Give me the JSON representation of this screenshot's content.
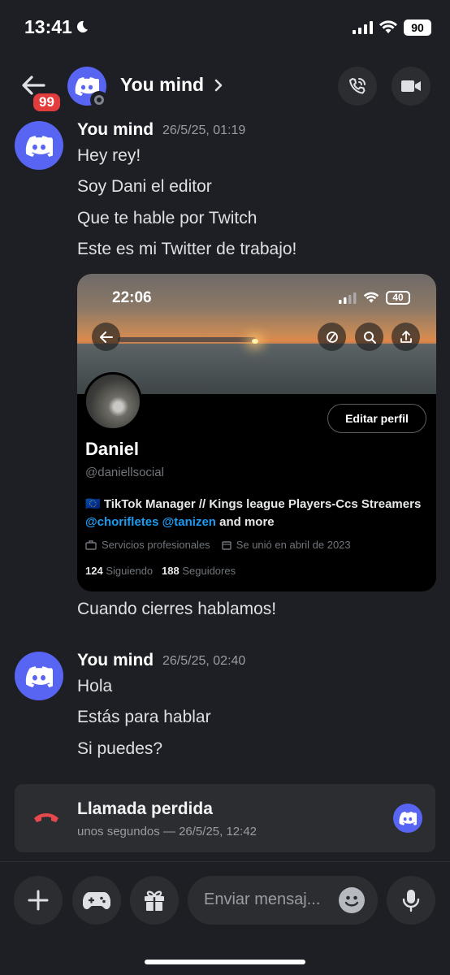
{
  "status_bar": {
    "time": "13:41",
    "battery": "90"
  },
  "header": {
    "unread_count": "99",
    "title": "You mind"
  },
  "messages": [
    {
      "author": "You mind",
      "timestamp": "26/5/25, 01:19",
      "lines": [
        "Hey rey!",
        "Soy Dani el editor",
        "Que te hable por Twitch",
        "Este es mi Twitter de trabajo!"
      ]
    },
    {
      "lines": [
        "Cuando cierres hablamos!"
      ]
    },
    {
      "author": "You mind",
      "timestamp": "26/5/25, 02:40",
      "lines": [
        "Hola",
        "Estás para hablar",
        "Si puedes?"
      ]
    }
  ],
  "embed": {
    "phone_time": "22:06",
    "phone_battery": "40",
    "edit_button": "Editar perfil",
    "name": "Daniel",
    "handle": "@daniellsocial",
    "bio_prefix": "🇪🇺 TikTok Manager // Kings league Players-Ccs Streamers ",
    "bio_link1": "@chorifletes",
    "bio_link2": "@tanizen",
    "bio_suffix": " and more",
    "meta_services": "Servicios profesionales",
    "meta_joined": "Se unió en abril de 2023",
    "following_count": "124",
    "following_label": "Siguiendo",
    "followers_count": "188",
    "followers_label": "Seguidores"
  },
  "missed_call": {
    "title": "Llamada perdida",
    "subtitle": "unos segundos — 26/5/25, 12:42"
  },
  "composer": {
    "placeholder": "Enviar mensaj..."
  },
  "colors": {
    "accent": "#5865f2",
    "badge": "#e23c3c",
    "missed_call": "#e5484d",
    "link": "#1d9bf0"
  }
}
